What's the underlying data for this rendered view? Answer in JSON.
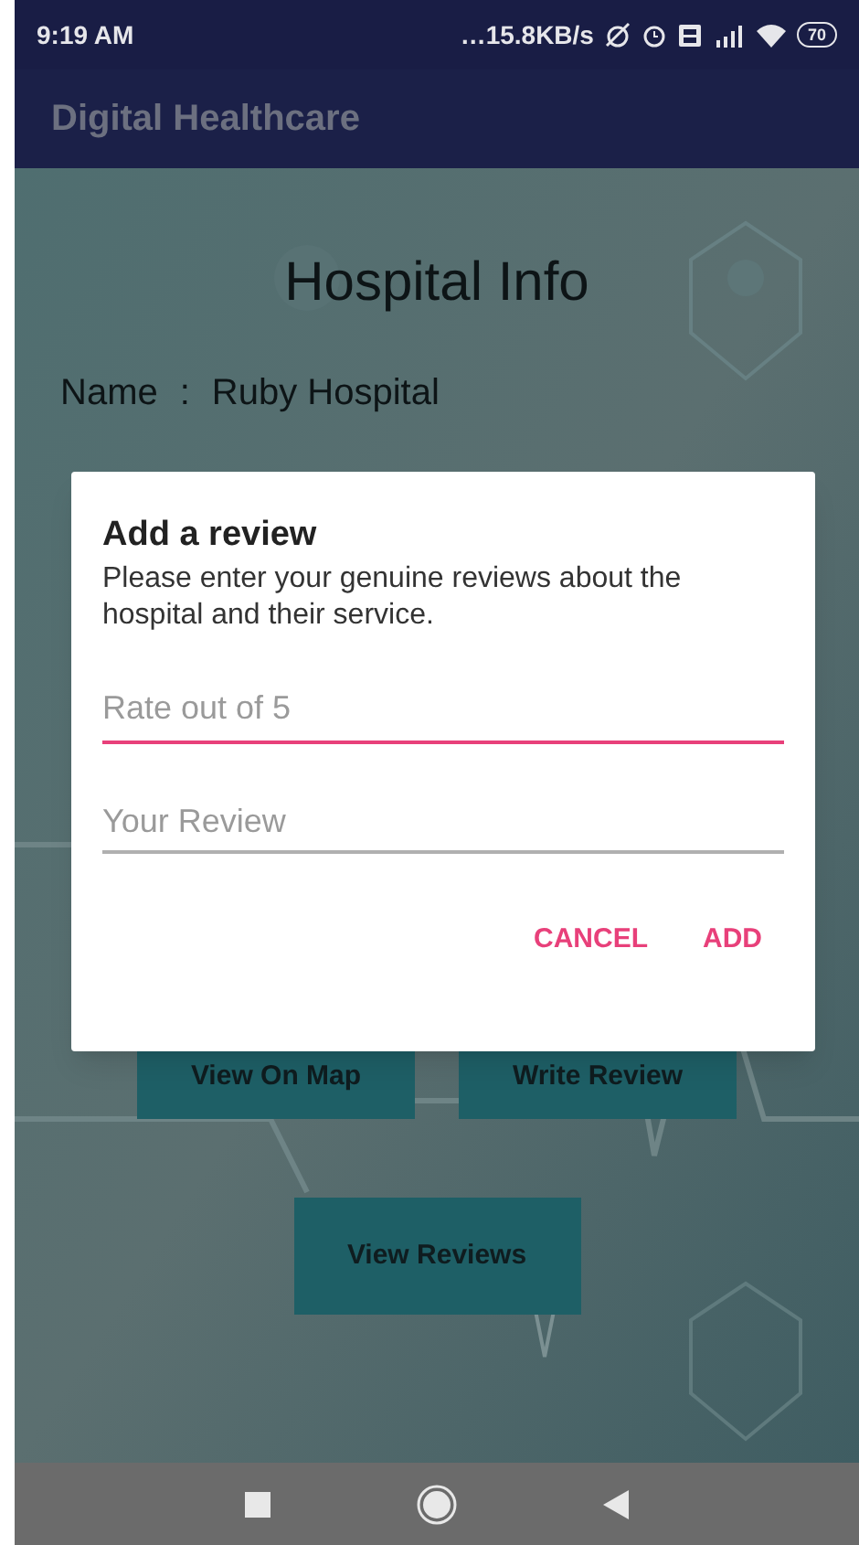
{
  "status_bar": {
    "time": "9:19 AM",
    "speed": "…15.8KB/s",
    "battery": "70"
  },
  "app_bar": {
    "title": "Digital Healthcare"
  },
  "page": {
    "title": "Hospital Info",
    "name_row": {
      "label": "Name",
      "separator": ":",
      "value": "Ruby Hospital"
    },
    "buttons": [
      {
        "label": "View On Map"
      },
      {
        "label": "Write Review"
      },
      {
        "label": "View Reviews"
      }
    ]
  },
  "dialog": {
    "title": "Add a review",
    "message": "Please enter your genuine reviews about the hospital and their service.",
    "fields": [
      {
        "placeholder": "Rate out of 5",
        "focused": true
      },
      {
        "placeholder": "Your Review",
        "focused": false
      }
    ],
    "actions": [
      {
        "label": "CANCEL"
      },
      {
        "label": "ADD"
      }
    ]
  }
}
